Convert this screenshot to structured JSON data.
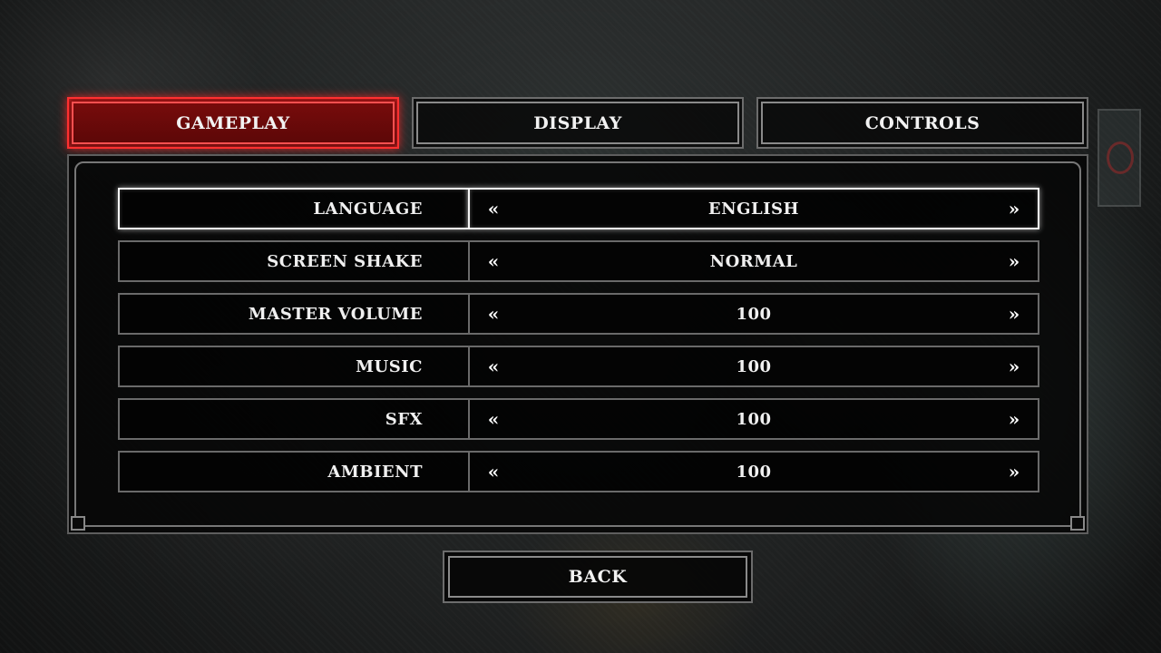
{
  "tabs": {
    "gameplay": "GAMEPLAY",
    "display": "DISPLAY",
    "controls": "CONTROLS",
    "active": "gameplay"
  },
  "settings": [
    {
      "label": "LANGUAGE",
      "value": "ENGLISH",
      "selected": true
    },
    {
      "label": "SCREEN SHAKE",
      "value": "NORMAL",
      "selected": false
    },
    {
      "label": "MASTER VOLUME",
      "value": "100",
      "selected": false
    },
    {
      "label": "MUSIC",
      "value": "100",
      "selected": false
    },
    {
      "label": "SFX",
      "value": "100",
      "selected": false
    },
    {
      "label": "AMBIENT",
      "value": "100",
      "selected": false
    }
  ],
  "arrows": {
    "left": "«",
    "right": "»",
    "left_icon": "double-chevron-left-icon",
    "right_icon": "double-chevron-right-icon"
  },
  "back_label": "BACK",
  "colors": {
    "active_tab": "#7a0c0c",
    "active_glow": "#ff3030",
    "border": "#6a6a6a",
    "text": "#f0f0f0"
  }
}
